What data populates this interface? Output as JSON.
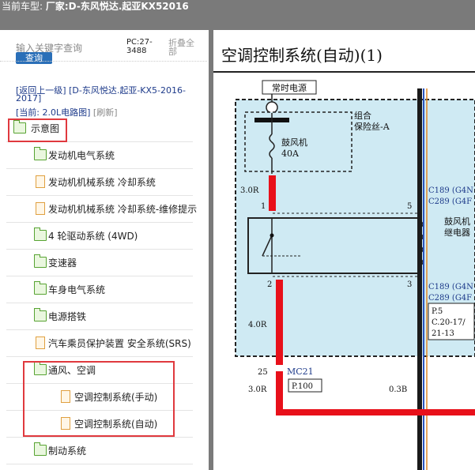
{
  "header": {
    "label": "当前车型:",
    "model": "厂家:D-东风悦达.起亚KX52016"
  },
  "search": {
    "placeholder": "输入关键字查询",
    "button": "查询",
    "count": "PC:27-3488",
    "collapse": "折叠全部"
  },
  "nav": {
    "back": "[返回上一级]",
    "back_path": "[D-东风悦达.起亚-KX5-2016-2017]",
    "current_label": "[当前:",
    "current_value": "2.0L电路图]",
    "refresh": "[刷新]"
  },
  "tree": [
    {
      "label": "示意图",
      "type": "folder"
    },
    {
      "label": "发动机电气系统",
      "type": "folder"
    },
    {
      "label": "发动机机械系统 冷却系统",
      "type": "doc"
    },
    {
      "label": "发动机机械系统 冷却系统-维修提示",
      "type": "doc"
    },
    {
      "label": "4 轮驱动系统 (4WD)",
      "type": "folder"
    },
    {
      "label": "变速器",
      "type": "folder"
    },
    {
      "label": "车身电气系统",
      "type": "folder"
    },
    {
      "label": "电源搭铁",
      "type": "folder"
    },
    {
      "label": "汽车乘员保护装置 安全系统(SRS)",
      "type": "doc"
    },
    {
      "label": "通风、空调",
      "type": "folder"
    },
    {
      "label": "空调控制系统(手动)",
      "type": "doc"
    },
    {
      "label": "空调控制系统(自动)",
      "type": "doc"
    },
    {
      "label": "制动系统",
      "type": "folder"
    }
  ],
  "diagram": {
    "title": "空调控制系统(自动)(1)",
    "power_label": "常时电源",
    "fuse_group": [
      "组合",
      "保险丝-A"
    ],
    "fuse_name": [
      "鼓风机",
      "40A"
    ],
    "relay_name": [
      "鼓风机",
      "继电器"
    ],
    "wire_top": "3.0R",
    "wire_mid": "4.0R",
    "wire_bot": "3.0R",
    "wire_black": "0.3B",
    "pin1": "1",
    "pin2": "2",
    "pin3": "3",
    "pin5": "5",
    "pin25": "25",
    "conn_top": [
      "C189 (G4N",
      "C289 (G4F"
    ],
    "conn_bot": [
      "C189 (G4N",
      "C289 (G4F"
    ],
    "page_ref": [
      "P.5",
      "C.20-17/",
      "21-13"
    ],
    "mc21": "MC21",
    "p100": "P.100"
  }
}
